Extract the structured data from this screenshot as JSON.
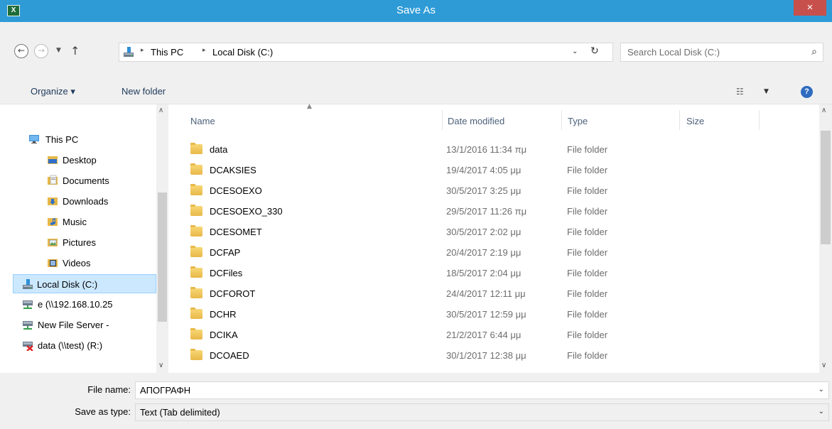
{
  "window": {
    "title": "Save As",
    "app_icon_text": "X",
    "close_glyph": "×"
  },
  "nav": {
    "back_glyph": "←",
    "forward_glyph": "→",
    "recent_glyph": "▼",
    "up_glyph": "↑"
  },
  "address": {
    "crumbs": [
      "This PC",
      "Local Disk (C:)"
    ],
    "separator_glyph": "▸",
    "dropdown_glyph": "⌄",
    "refresh_glyph": "↻"
  },
  "search": {
    "placeholder": "Search Local Disk (C:)",
    "icon_glyph": "⌕"
  },
  "toolbar": {
    "organize_label": "Organize ▾",
    "new_folder_label": "New folder",
    "view_glyph": "☷",
    "view_dropdown_glyph": "▼",
    "help_glyph": "?"
  },
  "tree": [
    {
      "label": "This PC",
      "icon": "pc-icon"
    },
    {
      "label": "Desktop",
      "icon": "desktop-icon"
    },
    {
      "label": "Documents",
      "icon": "documents-icon"
    },
    {
      "label": "Downloads",
      "icon": "downloads-icon"
    },
    {
      "label": "Music",
      "icon": "music-icon"
    },
    {
      "label": "Pictures",
      "icon": "pictures-icon"
    },
    {
      "label": "Videos",
      "icon": "videos-icon"
    },
    {
      "label": "Local Disk (C:)",
      "icon": "drive-icon",
      "selected": true
    },
    {
      "label": "e (\\\\192.168.10.25",
      "icon": "network-drive-icon"
    },
    {
      "label": "New File Server -",
      "icon": "network-drive-icon"
    },
    {
      "label": "data (\\\\test) (R:)",
      "icon": "disconnected-drive-icon"
    }
  ],
  "columns": {
    "name": "Name",
    "date": "Date modified",
    "type": "Type",
    "size": "Size"
  },
  "files": [
    {
      "name": "data",
      "date": "13/1/2016 11:34 πμ",
      "type": "File folder"
    },
    {
      "name": "DCAKSIES",
      "date": "19/4/2017 4:05 μμ",
      "type": "File folder"
    },
    {
      "name": "DCESOEXO",
      "date": "30/5/2017 3:25 μμ",
      "type": "File folder"
    },
    {
      "name": "DCESOEXO_330",
      "date": "29/5/2017 11:26 πμ",
      "type": "File folder"
    },
    {
      "name": "DCESOMET",
      "date": "30/5/2017 2:02 μμ",
      "type": "File folder"
    },
    {
      "name": "DCFAP",
      "date": "20/4/2017 2:19 μμ",
      "type": "File folder"
    },
    {
      "name": "DCFiles",
      "date": "18/5/2017 2:04 μμ",
      "type": "File folder"
    },
    {
      "name": "DCFOROT",
      "date": "24/4/2017 12:11 μμ",
      "type": "File folder"
    },
    {
      "name": "DCHR",
      "date": "30/5/2017 12:59 μμ",
      "type": "File folder"
    },
    {
      "name": "DCIKA",
      "date": "21/2/2017 6:44 μμ",
      "type": "File folder"
    },
    {
      "name": "DCOAED",
      "date": "30/1/2017 12:38 μμ",
      "type": "File folder"
    }
  ],
  "form": {
    "file_name_label": "File name:",
    "file_name_value": "ΑΠΟΓΡΑΦΗ",
    "save_type_label": "Save as type:",
    "save_type_value": "Text (Tab delimited)",
    "dropdown_glyph": "⌄"
  },
  "scroll": {
    "up_glyph": "∧",
    "down_glyph": "∨"
  },
  "colors": {
    "titlebar": "#2e9bd7",
    "close": "#c7504c",
    "selection": "#cce8ff"
  }
}
